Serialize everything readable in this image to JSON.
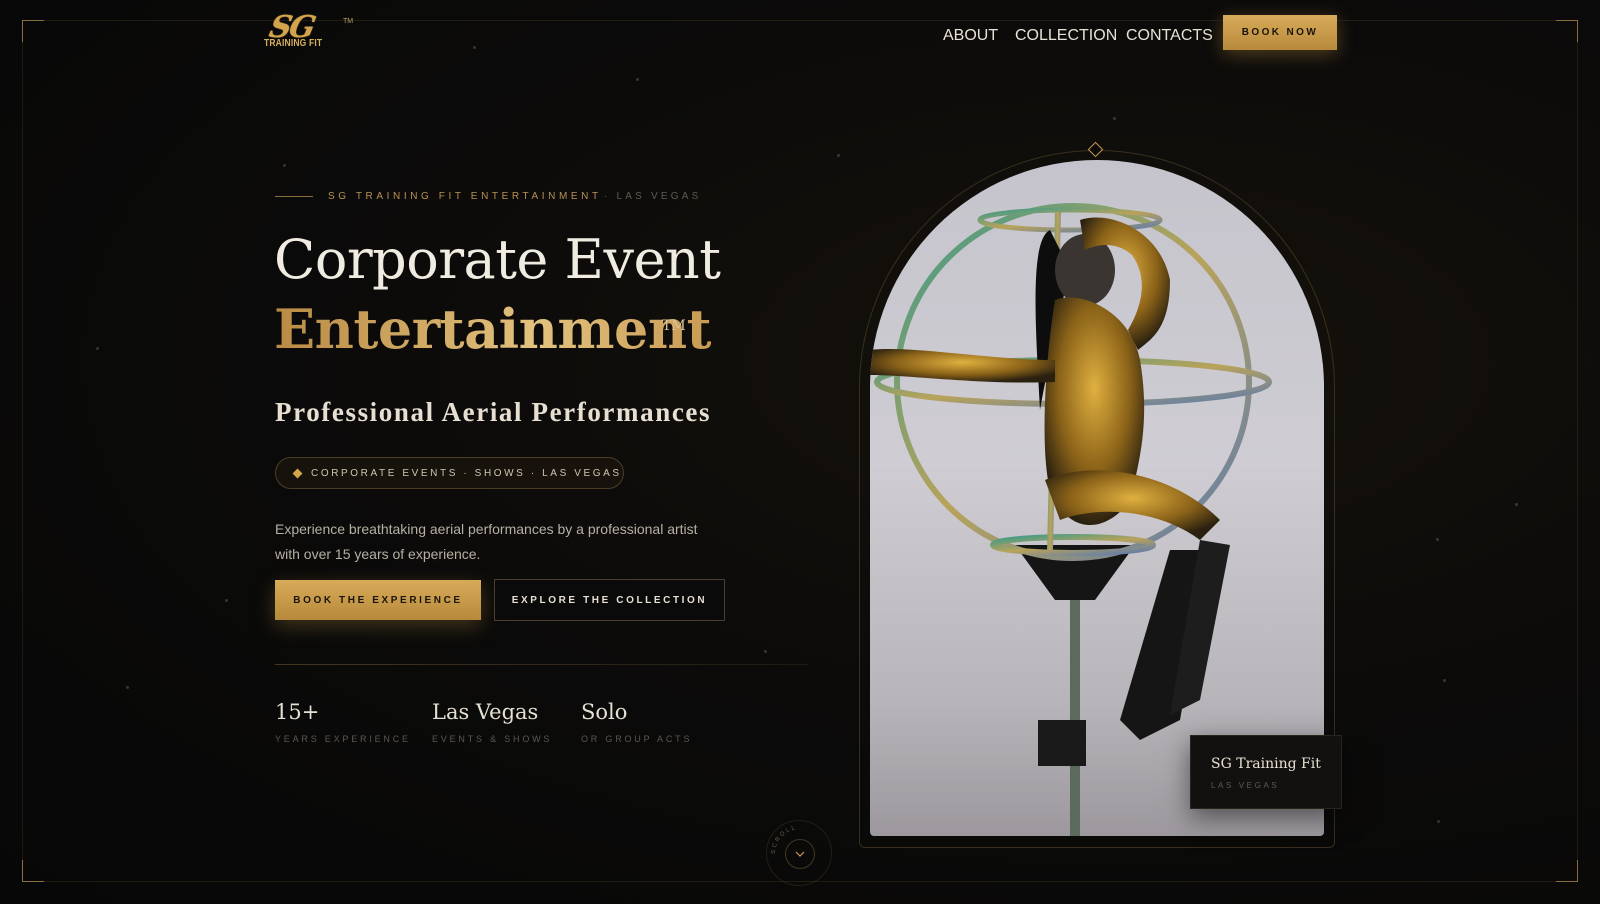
{
  "brand": {
    "logo_mark": "SG",
    "logo_sub": "TRAINING FIT",
    "logo_tm": "TM"
  },
  "nav": {
    "items": [
      "ABOUT",
      "COLLECTION",
      "CONTACTS"
    ],
    "book_now": "BOOK NOW"
  },
  "hero": {
    "eyebrow": "SG TRAINING FIT ENTERTAINMENT",
    "eyebrow_sub": "· LAS VEGAS",
    "title_line1": "Corporate Event",
    "title_line2": "Entertainment",
    "title_tm": "TM",
    "subtitle": "Professional Aerial Performances",
    "pill": "CORPORATE EVENTS · SHOWS · LAS VEGAS",
    "description": "Experience breathtaking aerial performances by a professional artist with over 15 years of experience.",
    "cta_primary": "BOOK THE EXPERIENCE",
    "cta_secondary": "EXPLORE THE COLLECTION"
  },
  "stats": [
    {
      "value": "15+",
      "label": "YEARS EXPERIENCE"
    },
    {
      "value": "Las Vegas",
      "label": "EVENTS & SHOWS"
    },
    {
      "value": "Solo",
      "label": "OR GROUP ACTS"
    }
  ],
  "caption": {
    "title": "SG Training Fit",
    "subtitle": "LAS VEGAS"
  },
  "scroll": {
    "label": "SCROLL"
  },
  "colors": {
    "gold": "#d4a44a",
    "background": "#0b0a09",
    "text": "#e8e2d6"
  }
}
